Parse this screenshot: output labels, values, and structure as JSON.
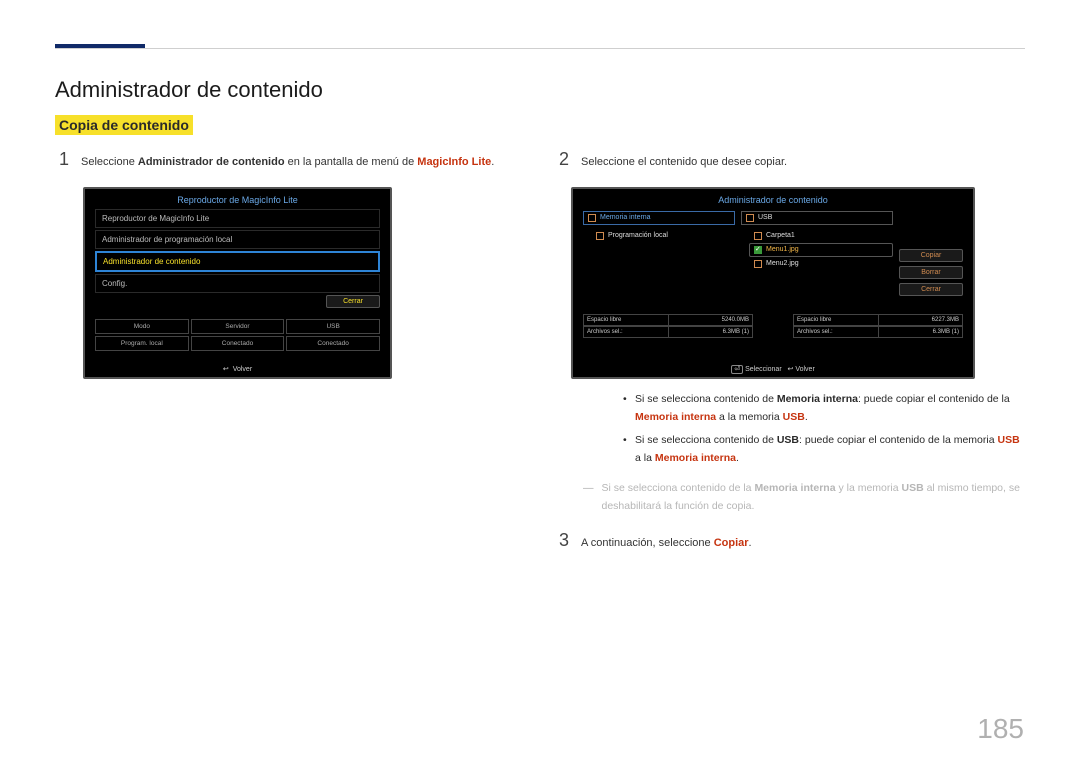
{
  "h1": "Administrador de contenido",
  "h2": "Copia de contenido",
  "pagenum": "185",
  "step1": {
    "n": "1",
    "pre": "Seleccione ",
    "strong": "Administrador de contenido",
    "mid": " en la pantalla de menú de ",
    "brand": "MagicInfo Lite",
    "post": "."
  },
  "screen1": {
    "title": "Reproductor de MagicInfo Lite",
    "items": [
      "Reproductor de MagicInfo Lite",
      "Administrador de programación local",
      "Administrador de contenido",
      "Config."
    ],
    "close": "Cerrar",
    "grid": [
      "Modo",
      "Servidor",
      "USB",
      "Program. local",
      "Conectado",
      "Conectado"
    ],
    "foot": "Volver"
  },
  "step2": {
    "n": "2",
    "txt": "Seleccione el contenido que desee copiar."
  },
  "screen2": {
    "title": "Administrador de contenido",
    "left_hdr": "Memoria interna",
    "left_item": "Programación local",
    "mid_hdr": "USB",
    "mid_items": [
      "Carpeta1",
      "Menu1.jpg",
      "Menu2.jpg"
    ],
    "btns": [
      "Copiar",
      "Borrar",
      "Cerrar"
    ],
    "stats": {
      "l1": [
        "Espacio libre",
        "5240.0MB"
      ],
      "l2": [
        "Archivos sel.:",
        "6.3MB (1)"
      ],
      "r1": [
        "Espacio libre",
        "6227.3MB"
      ],
      "r2": [
        "Archivos sel.:",
        "6.3MB (1)"
      ]
    },
    "foot1": "Seleccionar",
    "foot2": "Volver"
  },
  "bullets": {
    "b1": {
      "pre": "Si se selecciona contenido de ",
      "s1": "Memoria interna",
      "mid": ": puede copiar el contenido de la ",
      "s2": "Memoria interna",
      "mid2": " a la memoria ",
      "s3": "USB",
      "post": "."
    },
    "b2": {
      "pre": "Si se selecciona contenido de ",
      "s1": "USB",
      "mid": ": puede copiar el contenido de la memoria ",
      "s2": "USB",
      "mid2": " a la ",
      "s3": "Memoria interna",
      "post": "."
    }
  },
  "note": {
    "dash": "―",
    "a": "Si se selecciona contenido de la ",
    "s1": "Memoria interna",
    "b": " y la memoria ",
    "s2": "USB",
    "c": " al mismo tiempo, se deshabilitará la función de copia."
  },
  "step3": {
    "n": "3",
    "pre": "A continuación, seleccione ",
    "s": "Copiar",
    "post": "."
  }
}
